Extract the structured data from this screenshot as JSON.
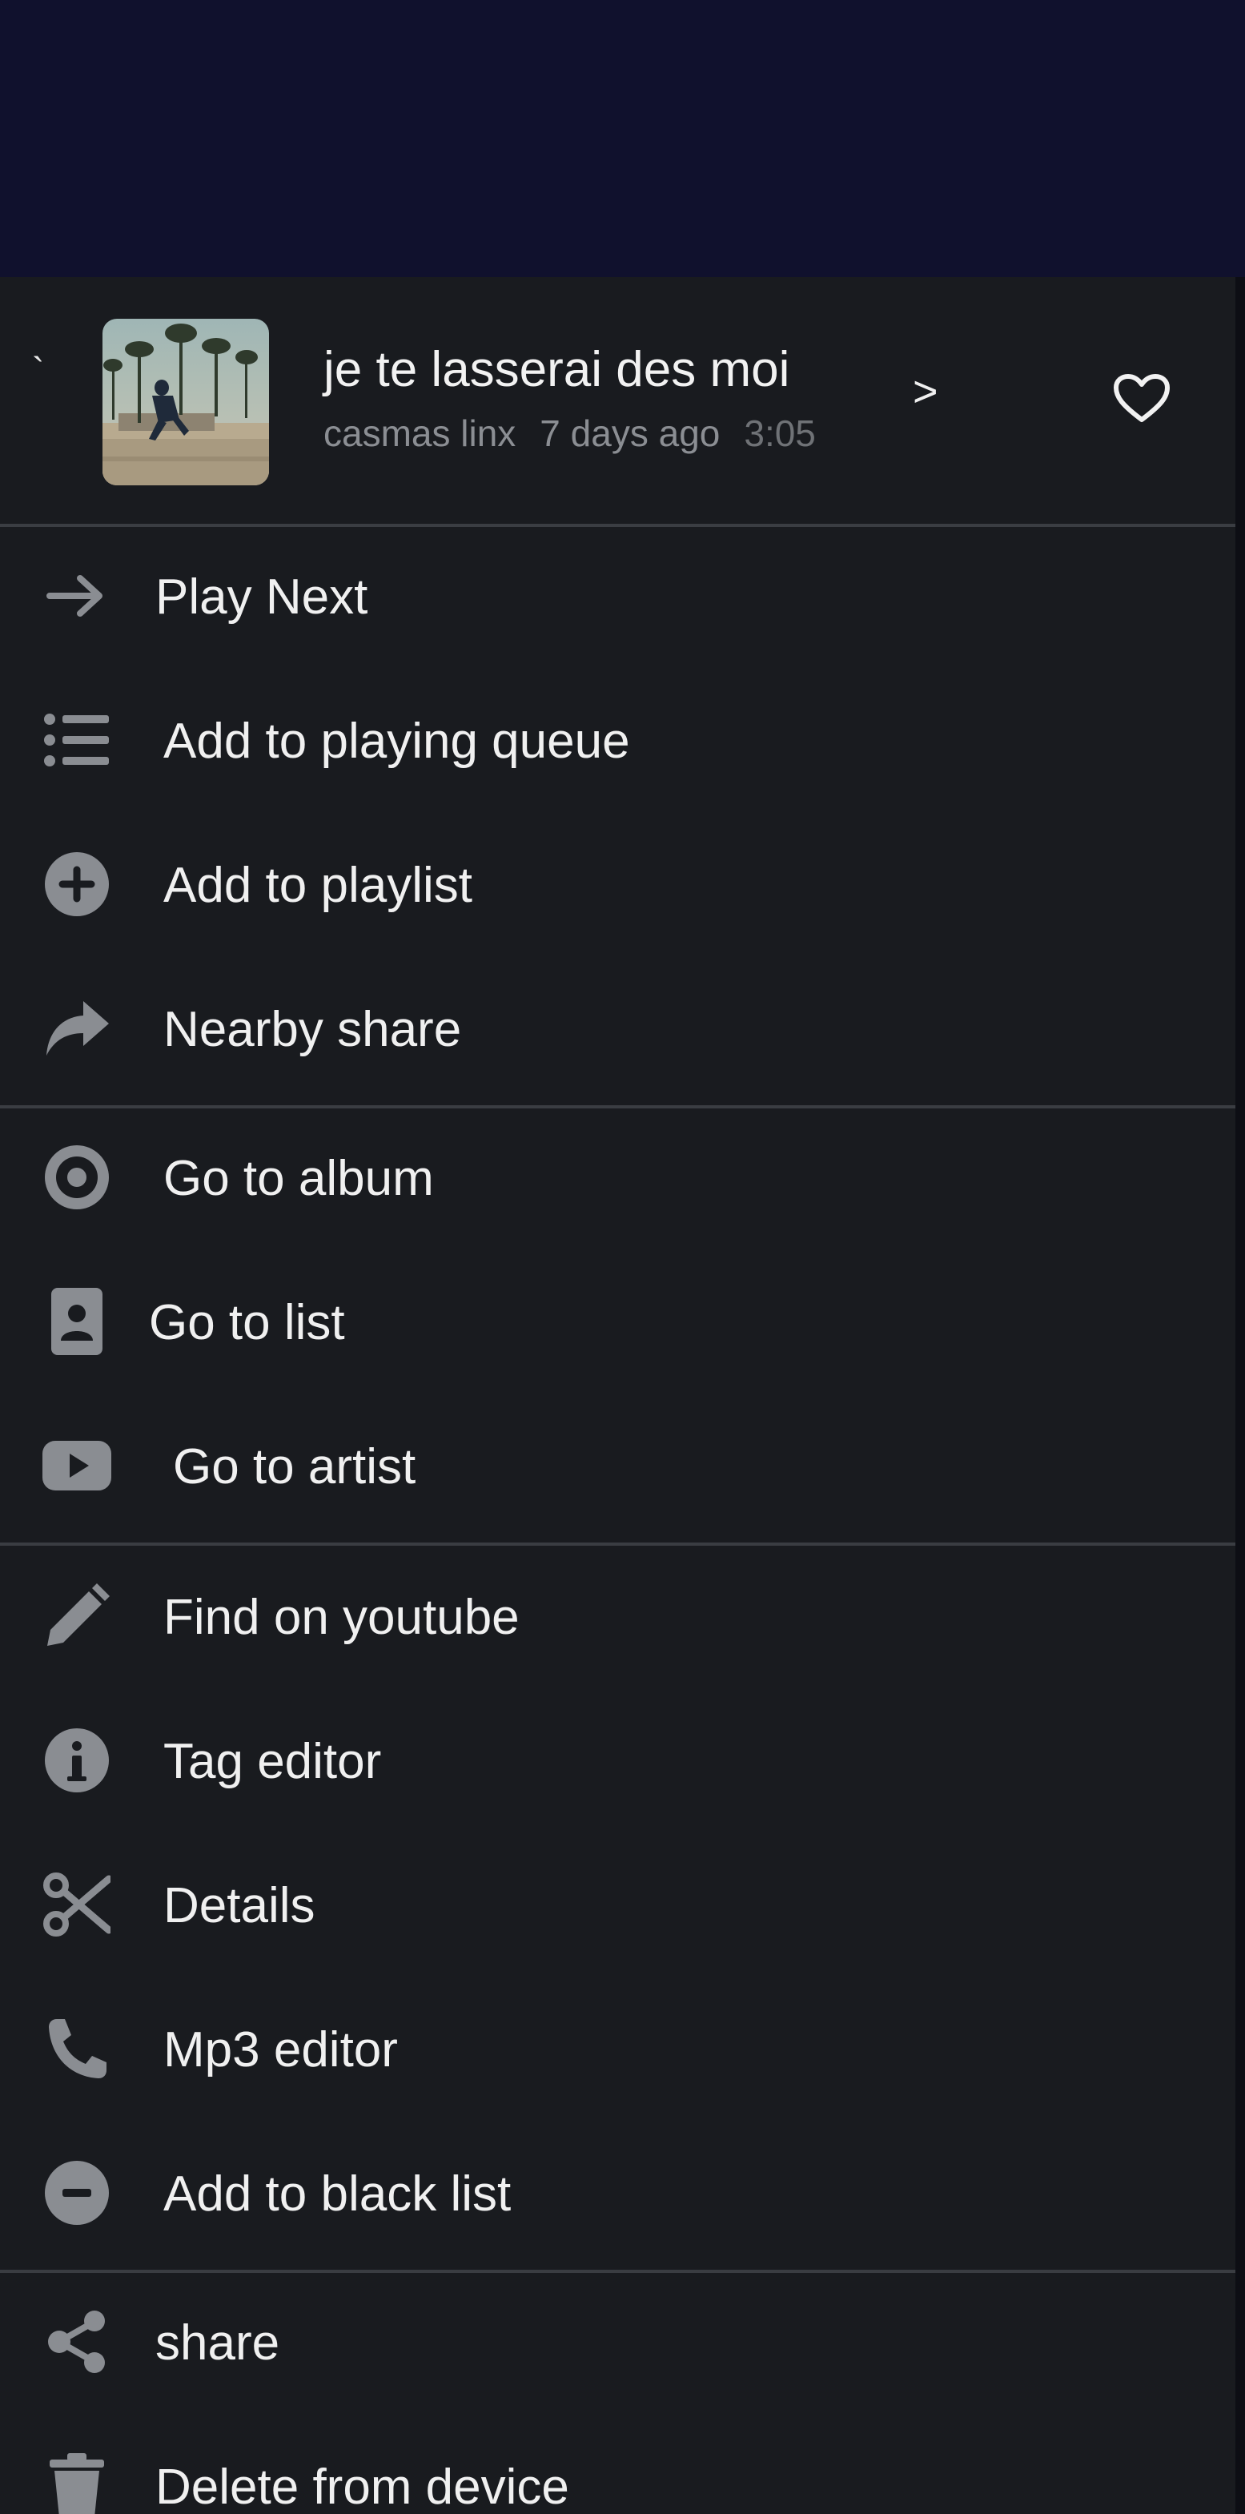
{
  "song": {
    "drag_mark": "`",
    "title": "je te lasserai des moi",
    "artist": "casmas linx",
    "added": "7 days ago",
    "duration": "3:05",
    "next_glyph": ">"
  },
  "menu": [
    {
      "label": "Play Next",
      "icon": "arrow-right-icon"
    },
    {
      "label": "Add to playing queue",
      "icon": "list-icon"
    },
    {
      "label": "Add to playlist",
      "icon": "plus-circle-icon"
    },
    {
      "label": "Nearby share",
      "icon": "share-arrow-icon"
    },
    {
      "label": "Go to album",
      "icon": "disc-icon"
    },
    {
      "label": "Go to list",
      "icon": "contact-card-icon"
    },
    {
      "label": "Go to artist",
      "icon": "youtube-icon"
    },
    {
      "label": "Find on youtube",
      "icon": "pencil-icon"
    },
    {
      "label": "Tag editor",
      "icon": "info-icon"
    },
    {
      "label": "Details",
      "icon": "scissors-icon"
    },
    {
      "label": "Mp3 editor",
      "icon": "phone-icon"
    },
    {
      "label": "Add to black list",
      "icon": "minus-circle-icon"
    },
    {
      "label": "share",
      "icon": "share-nodes-icon"
    },
    {
      "label": "Delete from device",
      "icon": "trash-icon"
    }
  ],
  "colors": {
    "top_bar": "#10112d",
    "sheet": "#191b1f",
    "icon": "#8a8d92",
    "text": "#f0f0f0",
    "divider": "#3a3d42"
  }
}
